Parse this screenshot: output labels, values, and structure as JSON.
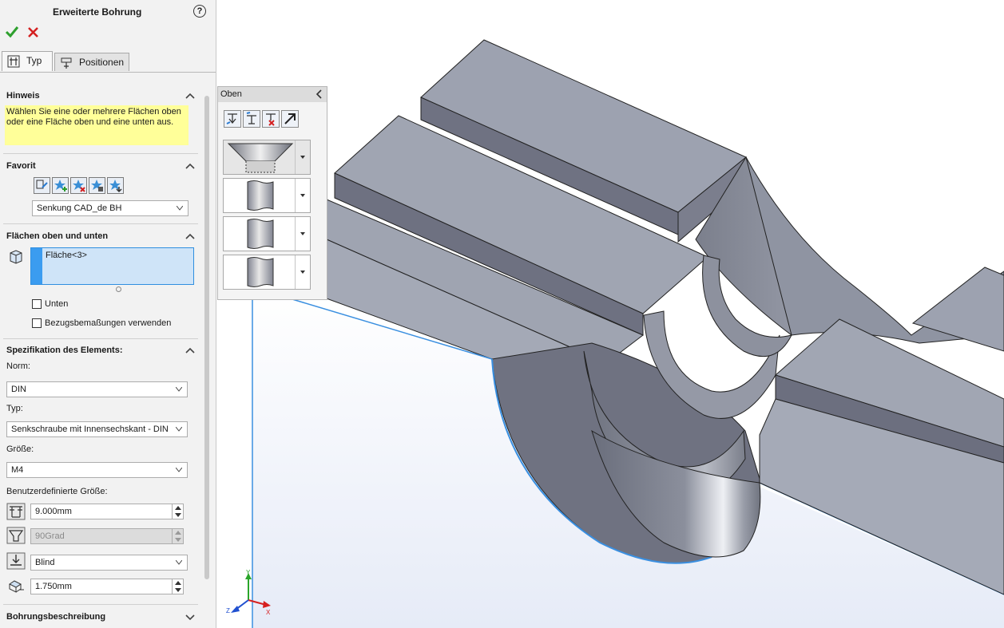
{
  "property_manager": {
    "title": "Erweiterte Bohrung",
    "help": "?",
    "tabs": [
      {
        "label": "Typ",
        "active": true
      },
      {
        "label": "Positionen",
        "active": false
      }
    ],
    "sections": {
      "hint": {
        "title": "Hinweis",
        "text": "Wählen Sie eine oder mehrere Flächen oben oder eine Fläche oben und eine unten aus."
      },
      "favorite": {
        "title": "Favorit",
        "selected": "Senkung CAD_de BH"
      },
      "faces": {
        "title": "Flächen oben und unten",
        "items": [
          "Fläche<3>"
        ],
        "checkbox_unten": "Unten",
        "checkbox_bezug": "Bezugsbemaßungen verwenden"
      },
      "element_spec": {
        "title": "Spezifikation des Elements:",
        "norm_label": "Norm:",
        "norm_value": "DIN",
        "typ_label": "Typ:",
        "typ_value": "Senkschraube mit Innensechskant - DIN",
        "size_label": "Größe:",
        "size_value": "M4",
        "custom_label": "Benutzerdefinierte Größe:",
        "diameter": "9.000mm",
        "angle": "90Grad",
        "end_condition": "Blind",
        "depth": "1.750mm"
      },
      "hole_description": {
        "title": "Bohrungsbeschreibung"
      }
    }
  },
  "flyout": {
    "title": "Oben"
  },
  "triad": {
    "x": "X",
    "y": "Y",
    "z": "Z"
  },
  "colors": {
    "accent": "#3b9cf0",
    "hint_bg": "#ffff99",
    "ok": "#2ea02e",
    "cancel": "#d42020",
    "model_top": "#9da3b0",
    "model_side": "#6d7080"
  }
}
